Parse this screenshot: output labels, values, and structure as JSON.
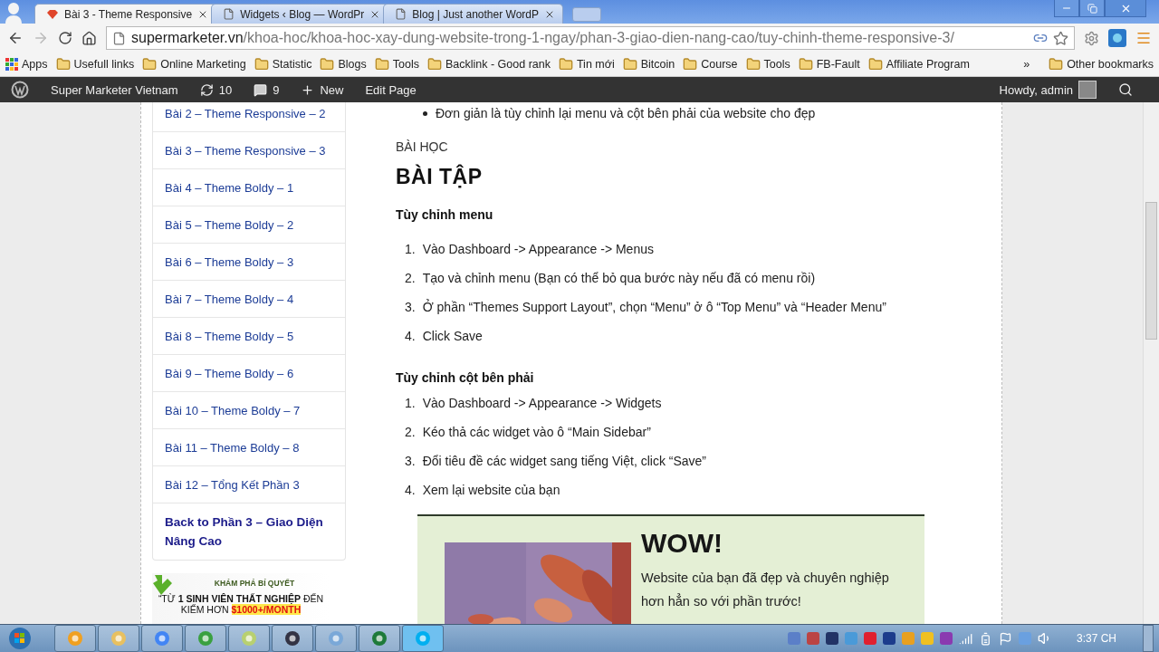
{
  "browser": {
    "tabs": [
      {
        "title": "Bài 3 - Theme Responsive",
        "selected": true
      },
      {
        "title": "Widgets ‹ Blog — WordPr",
        "selected": false
      },
      {
        "title": "Blog | Just another WordP",
        "selected": false
      }
    ],
    "url": {
      "domain": "supermarketer.vn",
      "path": "/khoa-hoc/khoa-hoc-xay-dung-website-trong-1-ngay/phan-3-giao-dien-nang-cao/tuy-chinh-theme-responsive-3/"
    },
    "bookmarks": [
      {
        "label": "Apps",
        "kind": "apps"
      },
      {
        "label": "Usefull links",
        "kind": "folder"
      },
      {
        "label": "Online Marketing",
        "kind": "folder"
      },
      {
        "label": "Statistic",
        "kind": "folder"
      },
      {
        "label": "Blogs",
        "kind": "folder"
      },
      {
        "label": "Tools",
        "kind": "folder"
      },
      {
        "label": "Backlink - Good rank",
        "kind": "folder"
      },
      {
        "label": "Tin mới",
        "kind": "folder"
      },
      {
        "label": "Bitcoin",
        "kind": "folder"
      },
      {
        "label": "Course",
        "kind": "folder"
      },
      {
        "label": "Tools",
        "kind": "folder"
      },
      {
        "label": "FB-Fault",
        "kind": "folder"
      },
      {
        "label": "Affiliate Program",
        "kind": "folder"
      }
    ],
    "bookmarks_overflow": "»",
    "other_bookmarks": "Other bookmarks"
  },
  "admin_bar": {
    "site": "Super Marketer Vietnam",
    "updates": "10",
    "comments": "9",
    "new": "New",
    "edit": "Edit Page",
    "howdy": "Howdy, admin"
  },
  "sidebar": {
    "lessons": [
      "Bài 2 – Theme Responsive – 2",
      "Bài 3 – Theme Responsive – 3",
      "Bài 4 – Theme Boldy – 1",
      "Bài 5 – Theme Boldy – 2",
      "Bài 6 – Theme Boldy – 3",
      "Bài 7 – Theme Boldy – 4",
      "Bài 8 – Theme Boldy – 5",
      "Bài 9 – Theme Boldy – 6",
      "Bài 10 – Theme Boldy – 7",
      "Bài 11 – Theme Boldy – 8",
      "Bài 12 – Tổng Kết Phần 3"
    ],
    "back_link": "Back to Phần 3 – Giao Diện Nâng Cao",
    "banner": {
      "heading": "KHÁM PHÁ BÍ QUYẾT",
      "line_1": "“TỪ **1 SINH VIÊN THẤT NGHIỆP** ĐẾN",
      "line_2_prefix": "KIẾM HƠN",
      "line_2_highlight": "$1000+/MONTH"
    }
  },
  "content": {
    "bullet": "Đơn giản là tùy chỉnh lại menu và cột bên phải của website cho đẹp",
    "label": "BÀI HỌC",
    "heading": "BÀI TẬP",
    "sections": [
      {
        "title": "Tùy chỉnh menu",
        "steps": [
          {
            "number": "1.",
            "text": "Vào Dashboard -> Appearance -> Menus"
          },
          {
            "number": "2.",
            "text": "Tạo và chỉnh menu  (Bạn có thể bỏ qua bước này nếu đã có menu rồi)"
          },
          {
            "number": "3.",
            "text": "Ở phần “Themes Support Layout”, chọn “Menu” ở ô “Top Menu” và “Header Menu”"
          },
          {
            "number": "4.",
            "text": "Click Save"
          }
        ]
      },
      {
        "title": "Tùy chỉnh cột bên phải",
        "steps": [
          {
            "number": "1.",
            "text": "Vào Dashboard -> Appearance -> Widgets"
          },
          {
            "number": "2.",
            "text": "Kéo thả các widget vào ô “Main Sidebar”"
          },
          {
            "number": "3.",
            "text": "Đổi tiêu đề các widget sang tiếng Việt, click “Save”"
          },
          {
            "number": "4.",
            "text": "Xem lại website của bạn"
          }
        ]
      }
    ],
    "promo": {
      "heading": "WOW!",
      "text": "Website của bạn đã đẹp và chuyên nghiệp hơn hẳn so với phần trước!"
    }
  },
  "taskbar": {
    "clock": "3:37 CH"
  }
}
